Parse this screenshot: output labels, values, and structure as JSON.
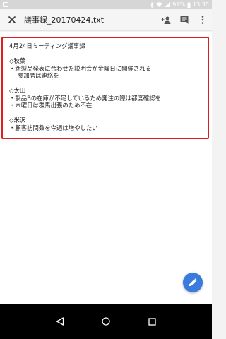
{
  "status_bar": {
    "battery": "99%",
    "time": "13:35"
  },
  "app_bar": {
    "title": "議事録_20170424.txt"
  },
  "document": {
    "lines": [
      "4月24日ミーティング議事録",
      "",
      "◇秋葉",
      "・新製品発表に合わせた説明会が金曜日に開催される",
      "参加者は連絡を",
      "",
      "◇太田",
      "・製品Bの在庫が不足しているため発注の際は都度確認を",
      "・木曜日は群馬出張のため不在",
      "",
      "◇米沢",
      "・顧客訪問数を今週は増やしたい"
    ]
  },
  "icons": {
    "close": "close-icon",
    "add_person": "add-person-icon",
    "comment": "comment-icon",
    "more": "more-vert-icon",
    "edit": "edit-icon",
    "back": "back-icon",
    "home": "home-icon",
    "recents": "recents-icon"
  },
  "colors": {
    "highlight_border": "#e01e1e",
    "fab": "#3a7be0"
  }
}
